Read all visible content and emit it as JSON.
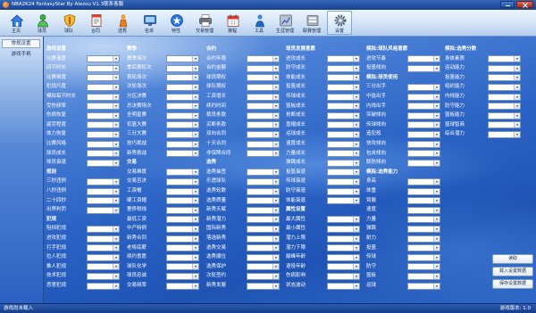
{
  "window": {
    "title": "NBA2K24 FantasyStar By Alezou V1.3联系客服"
  },
  "colors": {
    "titlebar": "#1e4a9c",
    "statusbar": "#1a4592",
    "panel": "#2b62c4",
    "toolbar": "#d3e3f6"
  },
  "toolbar": {
    "active_index": 12,
    "items": [
      {
        "label": "主页",
        "icon": "home-icon"
      },
      {
        "label": "球员",
        "icon": "player-icon"
      },
      {
        "label": "球队",
        "icon": "team-icon"
      },
      {
        "label": "合同",
        "icon": "contract-icon"
      },
      {
        "label": "选秀",
        "icon": "draft-icon"
      },
      {
        "label": "名单",
        "icon": "roster-icon"
      },
      {
        "label": "特性",
        "icon": "trait-icon"
      },
      {
        "label": "交易管理",
        "icon": "trade-icon"
      },
      {
        "label": "赛程",
        "icon": "schedule-icon"
      },
      {
        "label": "工具",
        "icon": "tools-icon"
      },
      {
        "label": "生涯管理",
        "icon": "career-icon"
      },
      {
        "label": "联赛管理",
        "icon": "league-icon"
      },
      {
        "label": "设置",
        "icon": "settings-icon"
      }
    ]
  },
  "sidebar": {
    "tabs": [
      {
        "label": "常规设置",
        "selected": true
      },
      {
        "label": "游戏手柄",
        "selected": false
      }
    ]
  },
  "settings": {
    "columns": [
      {
        "items": [
          {
            "header": "游戏设置"
          },
          {
            "label": "比赛速度",
            "value": ""
          },
          {
            "label": "四节时长",
            "value": ""
          },
          {
            "label": "比赛难度",
            "value": ""
          },
          {
            "label": "犯规尺度",
            "value": ""
          },
          {
            "label": "模拟每节时长",
            "value": ""
          },
          {
            "label": "受伤频率",
            "value": ""
          },
          {
            "label": "伤病恢复",
            "value": ""
          },
          {
            "label": "疲劳程度",
            "value": ""
          },
          {
            "label": "体力恢复",
            "value": ""
          },
          {
            "label": "比赛风格",
            "value": ""
          },
          {
            "label": "球员成长",
            "value": ""
          },
          {
            "label": "球员衰退",
            "value": ""
          },
          {
            "header": "规则"
          },
          {
            "label": "三秒违例",
            "value": ""
          },
          {
            "label": "八秒违例",
            "value": ""
          },
          {
            "label": "二十四秒",
            "value": ""
          },
          {
            "label": "出界判罚",
            "value": ""
          },
          {
            "header": "犯规"
          },
          {
            "label": "阻挡犯规",
            "value": ""
          },
          {
            "label": "进攻犯规",
            "value": ""
          },
          {
            "label": "打手犯规",
            "value": ""
          },
          {
            "label": "拉人犯规",
            "value": ""
          },
          {
            "label": "推人犯规",
            "value": ""
          },
          {
            "label": "技术犯规",
            "value": ""
          },
          {
            "label": "恶意犯规",
            "value": ""
          }
        ]
      },
      {
        "items": [
          {
            "header": "赛季"
          },
          {
            "label": "赛季场次",
            "value": ""
          },
          {
            "label": "季后赛轮次",
            "value": ""
          },
          {
            "label": "首轮场次",
            "value": ""
          },
          {
            "label": "次轮场次",
            "value": ""
          },
          {
            "label": "分区决赛",
            "value": ""
          },
          {
            "label": "总决赛场次",
            "value": ""
          },
          {
            "label": "全明星赛",
            "value": ""
          },
          {
            "label": "扣篮大赛",
            "value": ""
          },
          {
            "label": "三分大赛",
            "value": ""
          },
          {
            "label": "技巧挑战",
            "value": ""
          },
          {
            "label": "新秀挑战",
            "value": ""
          },
          {
            "header": "交易"
          },
          {
            "label": "交易难度",
            "value": ""
          },
          {
            "label": "交易否决",
            "value": ""
          },
          {
            "label": "工资帽",
            "value": ""
          },
          {
            "label": "硬工资帽",
            "value": ""
          },
          {
            "label": "奢侈税线",
            "value": ""
          },
          {
            "label": "最低工资",
            "value": ""
          },
          {
            "label": "中产特例",
            "value": ""
          },
          {
            "label": "新秀合同",
            "value": ""
          },
          {
            "label": "老将底薪",
            "value": ""
          },
          {
            "label": "续约意愿",
            "value": ""
          },
          {
            "label": "球队化学",
            "value": ""
          },
          {
            "label": "球员忠诚",
            "value": ""
          },
          {
            "label": "交易频率",
            "value": ""
          }
        ]
      },
      {
        "items": [
          {
            "header": "合约"
          },
          {
            "label": "合约年限",
            "value": ""
          },
          {
            "label": "合约金额",
            "value": ""
          },
          {
            "label": "球员期权",
            "value": ""
          },
          {
            "label": "球队期权",
            "value": ""
          },
          {
            "label": "工资增长",
            "value": ""
          },
          {
            "label": "续约时间",
            "value": ""
          },
          {
            "label": "裁员条款",
            "value": ""
          },
          {
            "label": "买断条款",
            "value": ""
          },
          {
            "label": "双向合同",
            "value": ""
          },
          {
            "label": "十天合同",
            "value": ""
          },
          {
            "label": "非保障合同",
            "value": ""
          },
          {
            "header": "选秀"
          },
          {
            "label": "选秀抽签",
            "value": ""
          },
          {
            "label": "乐透球队",
            "value": ""
          },
          {
            "label": "选秀轮数",
            "value": ""
          },
          {
            "label": "选秀质量",
            "value": ""
          },
          {
            "label": "新秀天赋",
            "value": ""
          },
          {
            "label": "新秀潜力",
            "value": ""
          },
          {
            "label": "国际新秀",
            "value": ""
          },
          {
            "label": "落选新秀",
            "value": ""
          },
          {
            "label": "选秀交易",
            "value": ""
          },
          {
            "label": "选秀顺位",
            "value": ""
          },
          {
            "label": "选秀保护",
            "value": ""
          },
          {
            "label": "次轮签约",
            "value": ""
          },
          {
            "label": "新秀发展",
            "value": ""
          }
        ]
      },
      {
        "items": [
          {
            "header": "球员发展意愿"
          },
          {
            "label": "进攻成长",
            "value": ""
          },
          {
            "label": "防守成长",
            "value": ""
          },
          {
            "label": "体能成长",
            "value": ""
          },
          {
            "label": "投篮成长",
            "value": ""
          },
          {
            "label": "传球成长",
            "value": ""
          },
          {
            "label": "篮板成长",
            "value": ""
          },
          {
            "label": "抢断成长",
            "value": ""
          },
          {
            "label": "盖帽成长",
            "value": ""
          },
          {
            "label": "运球成长",
            "value": ""
          },
          {
            "label": "速度成长",
            "value": ""
          },
          {
            "label": "力量成长",
            "value": ""
          },
          {
            "label": "弹跳成长",
            "value": ""
          },
          {
            "label": "投篮衰退",
            "value": ""
          },
          {
            "label": "传球衰退",
            "value": ""
          },
          {
            "label": "防守衰退",
            "value": ""
          },
          {
            "label": "体能衰退",
            "value": ""
          },
          {
            "header": "属性设置"
          },
          {
            "label": "最大属性",
            "value": ""
          },
          {
            "label": "最小属性",
            "value": ""
          },
          {
            "label": "潜力上限",
            "value": ""
          },
          {
            "label": "潜力下限",
            "value": ""
          },
          {
            "label": "巅峰年龄",
            "value": ""
          },
          {
            "label": "退役年龄",
            "value": ""
          },
          {
            "label": "伤病影响",
            "value": ""
          },
          {
            "label": "状态波动",
            "value": ""
          }
        ]
      },
      {
        "items": [
          {
            "header": "模拟:球队风格意愿"
          },
          {
            "label": "进攻节奏",
            "value": ""
          },
          {
            "label": "投篮倾向",
            "value": ""
          },
          {
            "header": "模拟:球员使用"
          },
          {
            "label": "三分出手",
            "value": ""
          },
          {
            "label": "中投出手",
            "value": ""
          },
          {
            "label": "内线出手",
            "value": ""
          },
          {
            "label": "突破倾向",
            "value": ""
          },
          {
            "label": "传球倾向",
            "value": ""
          },
          {
            "label": "造犯规",
            "value": ""
          },
          {
            "label": "快攻倾向",
            "value": ""
          },
          {
            "label": "包夹倾向",
            "value": ""
          },
          {
            "label": "联防倾向",
            "value": ""
          },
          {
            "header": "模拟:选秀能力"
          },
          {
            "label": "身高",
            "value": ""
          },
          {
            "label": "体重",
            "value": ""
          },
          {
            "label": "臂展",
            "value": ""
          },
          {
            "label": "速度",
            "value": ""
          },
          {
            "label": "力量",
            "value": ""
          },
          {
            "label": "弹跳",
            "value": ""
          },
          {
            "label": "耐力",
            "value": ""
          },
          {
            "label": "投篮",
            "value": ""
          },
          {
            "label": "传球",
            "value": ""
          },
          {
            "label": "防守",
            "value": ""
          },
          {
            "label": "篮板",
            "value": ""
          },
          {
            "label": "运球",
            "value": ""
          }
        ]
      },
      {
        "items": [
          {
            "header": "模拟:选秀分数"
          },
          {
            "label": "身体素质",
            "value": ""
          },
          {
            "label": "运动能力",
            "value": ""
          },
          {
            "label": "投篮能力",
            "value": ""
          },
          {
            "label": "组织能力",
            "value": ""
          },
          {
            "label": "内线能力",
            "value": ""
          },
          {
            "label": "防守能力",
            "value": ""
          },
          {
            "label": "篮板能力",
            "value": ""
          },
          {
            "label": "篮球智商",
            "value": ""
          },
          {
            "label": "综合潜力",
            "value": ""
          }
        ]
      }
    ]
  },
  "buttons": {
    "read": "读取",
    "load": "载入设置数据",
    "save": "保存设置数据"
  },
  "status": {
    "left": "游戏尚未载入",
    "right": "游戏版本: 1.0"
  }
}
